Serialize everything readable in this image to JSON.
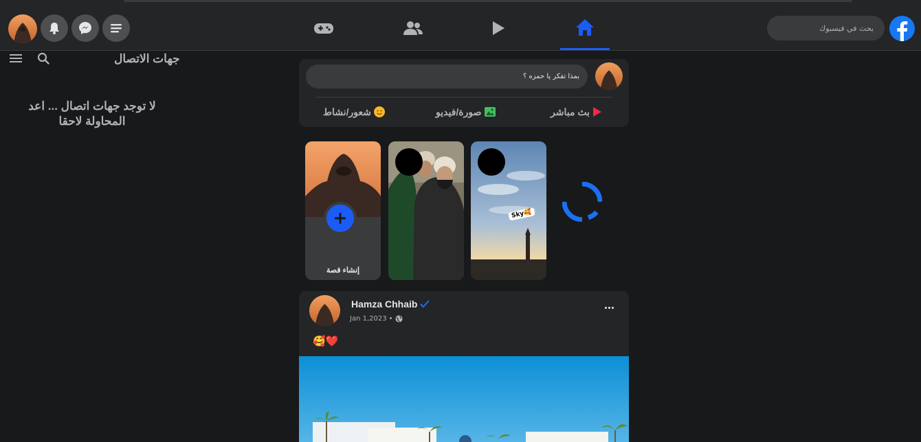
{
  "navbar": {
    "search_placeholder": "بحث في فيسبوك",
    "tabs": [
      {
        "name": "games",
        "icon": "gamepad-icon",
        "active": false
      },
      {
        "name": "friends",
        "icon": "friends-icon",
        "active": false
      },
      {
        "name": "watch",
        "icon": "play-icon",
        "active": false
      },
      {
        "name": "home",
        "icon": "home-icon",
        "active": true
      }
    ],
    "right_buttons": [
      "menu-icon",
      "messenger-icon",
      "bell-icon"
    ],
    "accent_color": "#1b5cf5"
  },
  "sidebar": {
    "title": "جهات الاتصال",
    "empty_message": "لا توجد جهات اتصال ... اعد المحاولة لاحقا"
  },
  "composer": {
    "placeholder": "بمذا تفكر يا حمزه ؟",
    "actions": [
      {
        "label": "بث مباشر",
        "icon": "live-icon",
        "color": "#f02849"
      },
      {
        "label": "صورة/فيديو",
        "icon": "photo-icon",
        "color": "#45bd62"
      },
      {
        "label": "شعور/نشاط",
        "icon": "smile-icon",
        "color": "#f7b928"
      }
    ]
  },
  "stories": {
    "create_label": "إنشاء قصة",
    "items": [
      {
        "tag": ""
      },
      {
        "tag": "Sky🥰"
      }
    ]
  },
  "post": {
    "author": "Hamza Chhaib",
    "verified": true,
    "date": "Jan 1,2023",
    "privacy_icon": "globe-icon",
    "text": "🥰❤️"
  }
}
